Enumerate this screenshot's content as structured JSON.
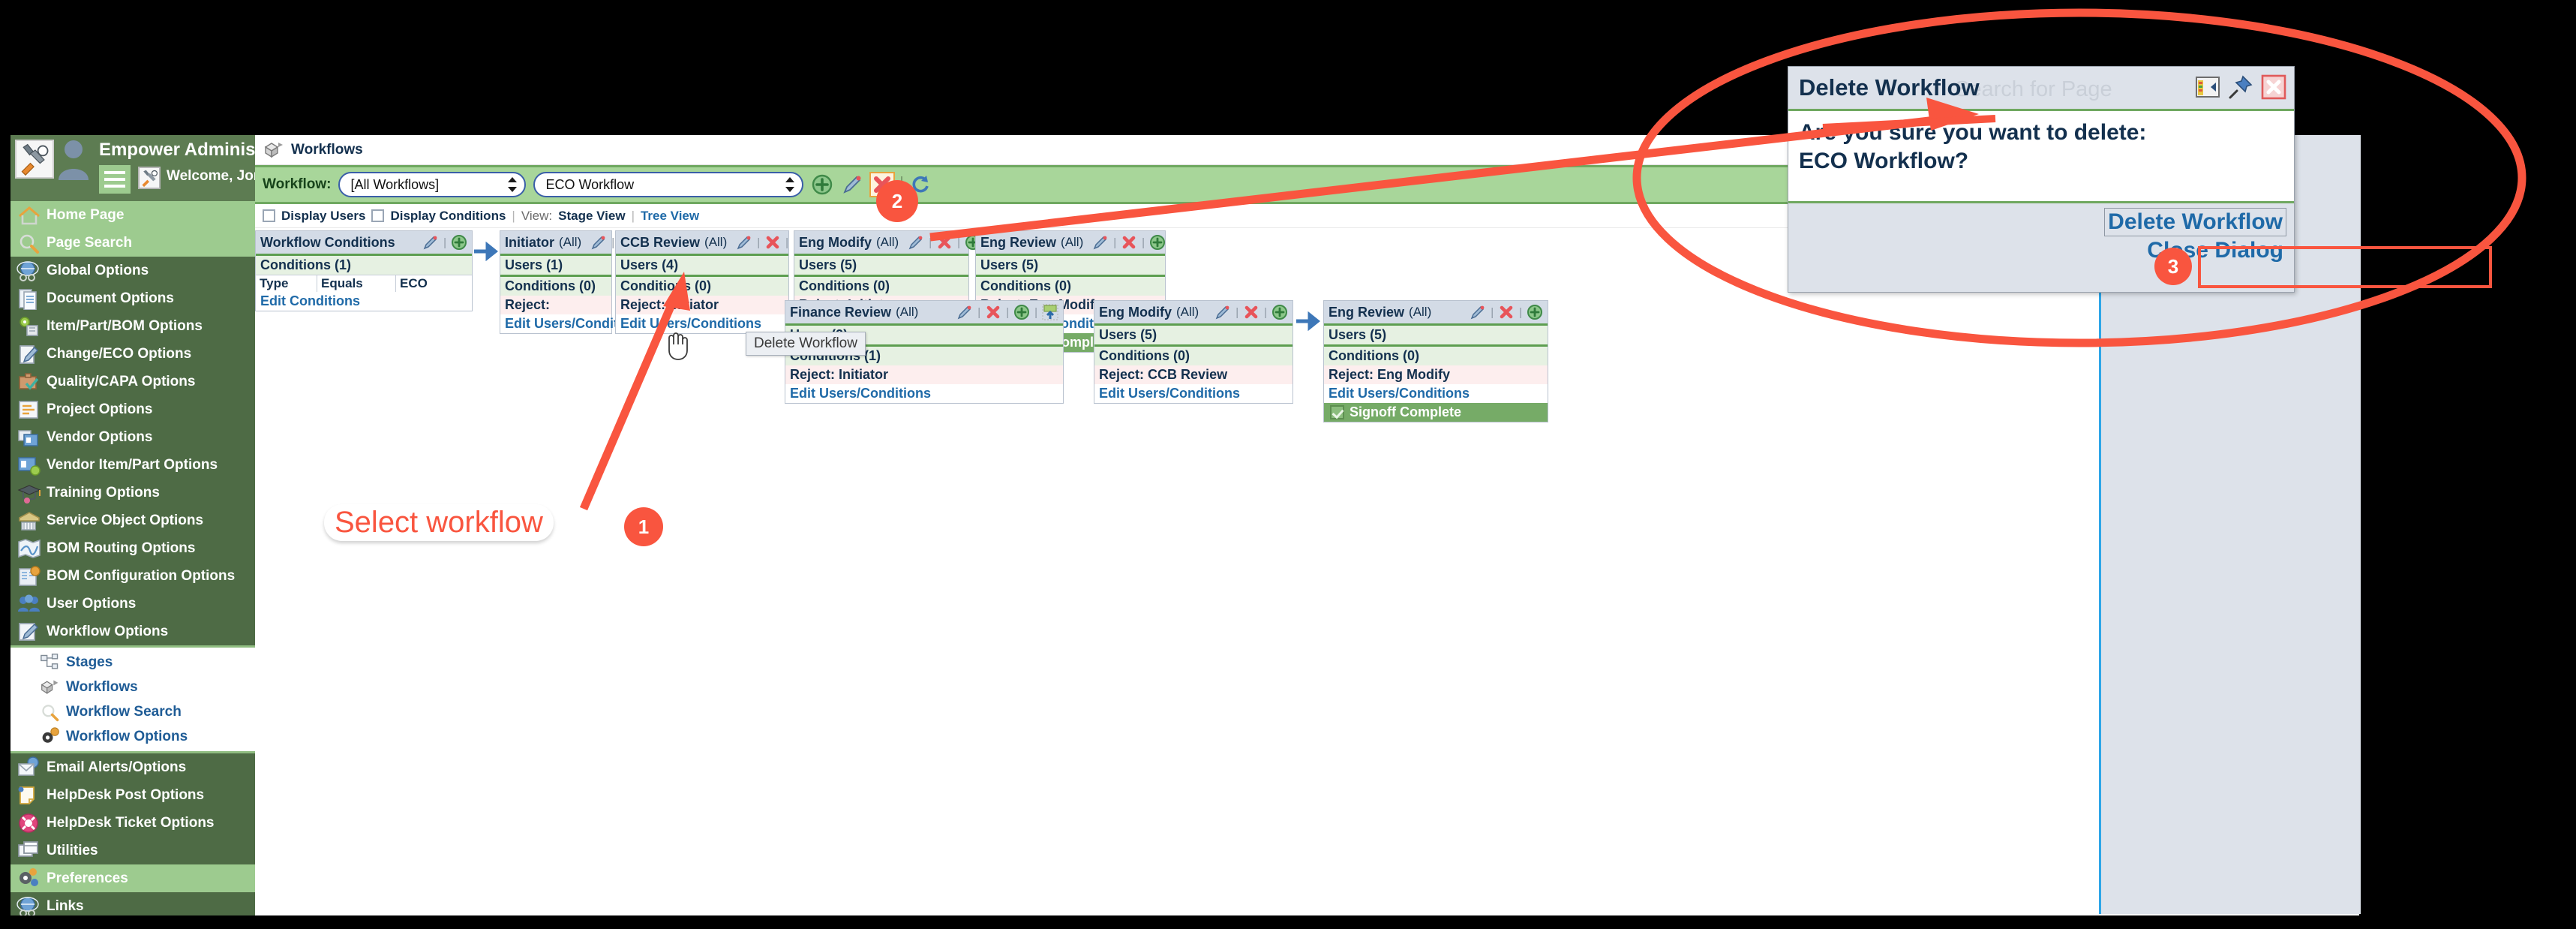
{
  "header": {
    "app_title": "Empower Administrator",
    "welcome": "Welcome, Jonathan Cohn",
    "logo_icon": "tools-logo-icon",
    "avatar_icon": "user-avatar-icon",
    "menu_icon": "hamburger-menu-icon",
    "caret_icon": "chevron-down-icon"
  },
  "sidebar": {
    "items": [
      {
        "label": "Home Page",
        "icon": "home-icon",
        "highlight": true
      },
      {
        "label": "Page Search",
        "icon": "magnifier-icon",
        "highlight": true
      },
      {
        "label": "Global Options",
        "icon": "globe-icon",
        "highlight": false
      },
      {
        "label": "Document Options",
        "icon": "documents-icon",
        "highlight": false
      },
      {
        "label": "Item/Part/BOM Options",
        "icon": "gear-chip-icon",
        "highlight": false
      },
      {
        "label": "Change/ECO Options",
        "icon": "notepad-pencil-icon",
        "highlight": false
      },
      {
        "label": "Quality/CAPA Options",
        "icon": "briefcase-check-icon",
        "highlight": false
      },
      {
        "label": "Project Options",
        "icon": "gantt-icon",
        "highlight": false
      },
      {
        "label": "Vendor Options",
        "icon": "vendor-cards-icon",
        "highlight": false
      },
      {
        "label": "Vendor Item/Part Options",
        "icon": "vendor-gear-icon",
        "highlight": false
      },
      {
        "label": "Training Options",
        "icon": "graduation-cap-icon",
        "highlight": false
      },
      {
        "label": "Service Object Options",
        "icon": "service-box-icon",
        "highlight": false
      },
      {
        "label": "BOM Routing Options",
        "icon": "routing-map-icon",
        "highlight": false
      },
      {
        "label": "BOM Configuration Options",
        "icon": "config-gear-icon",
        "highlight": false
      },
      {
        "label": "User Options",
        "icon": "users-group-icon",
        "highlight": false
      },
      {
        "label": "Workflow Options",
        "icon": "workflow-pencil-icon",
        "highlight": false
      }
    ],
    "subitems": [
      {
        "label": "Stages",
        "icon": "stages-icon"
      },
      {
        "label": "Workflows",
        "icon": "workflow-box-icon"
      },
      {
        "label": "Workflow Search",
        "icon": "magnifier-icon"
      },
      {
        "label": "Workflow Options",
        "icon": "gear-icon"
      }
    ],
    "items_after": [
      {
        "label": "Email Alerts/Options",
        "icon": "email-globe-icon",
        "highlight": false
      },
      {
        "label": "HelpDesk Post Options",
        "icon": "sticky-note-icon",
        "highlight": false
      },
      {
        "label": "HelpDesk Ticket Options",
        "icon": "lifering-icon",
        "highlight": false
      },
      {
        "label": "Utilities",
        "icon": "windows-stack-icon",
        "highlight": false
      },
      {
        "label": "Preferences",
        "icon": "gear-user-icon",
        "highlight": true
      },
      {
        "label": "Links",
        "icon": "globe-icon",
        "highlight": false
      }
    ]
  },
  "page": {
    "title": "Workflows",
    "title_icon": "workflow-box-icon"
  },
  "workflow_bar": {
    "label": "Workflow:",
    "filter_select_value": "[All Workflows]",
    "workflow_select_value": "ECO Workflow",
    "add_icon": "plus-circle-icon",
    "edit_icon": "pencil-icon",
    "delete_icon": "red-x-icon",
    "refresh_icon": "refresh-icon"
  },
  "options_bar": {
    "display_users": "Display Users",
    "display_conditions": "Display Conditions",
    "view_label": "View:",
    "view_current": "Stage View",
    "view_alt": "Tree View"
  },
  "tooltip": {
    "text": "Delete Workflow"
  },
  "cards": {
    "conditions": {
      "title": "Workflow Conditions",
      "conditions_label": "Conditions",
      "conditions_count": "(1)",
      "table": [
        "Type",
        "Equals",
        "ECO"
      ],
      "edit_link": "Edit Conditions"
    },
    "stages_row1": [
      {
        "title": "Initiator",
        "all": "(All)",
        "users": "Users",
        "users_count": "(1)",
        "conditions": "Conditions",
        "conditions_count": "(0)",
        "reject": "Reject:",
        "reject_to": "",
        "edit_link": "Edit Users/Conditions",
        "signoff": null,
        "has_delete": true,
        "has_export": false
      },
      {
        "title": "CCB Review",
        "all": "(All)",
        "users": "Users",
        "users_count": "(4)",
        "conditions": "Conditions",
        "conditions_count": "(0)",
        "reject": "Reject:",
        "reject_to": "Initiator",
        "edit_link": "Edit Users/Conditions",
        "signoff": null,
        "has_delete": true,
        "has_export": false
      },
      {
        "title": "Eng Modify",
        "all": "(All)",
        "users": "Users",
        "users_count": "(5)",
        "conditions": "Conditions",
        "conditions_count": "(0)",
        "reject": "Reject:",
        "reject_to": "Initiator",
        "edit_link": "Edit Users/Conditions",
        "signoff": null,
        "has_delete": true,
        "has_export": true
      },
      {
        "title": "Eng Review",
        "all": "(All)",
        "users": "Users",
        "users_count": "(5)",
        "conditions": "Conditions",
        "conditions_count": "(0)",
        "reject": "Reject:",
        "reject_to": "Eng Modify",
        "edit_link": "Edit Users/Conditions",
        "signoff": "Signoff Complete",
        "has_delete": true,
        "has_export": false
      }
    ],
    "stages_row2": [
      {
        "title": "Finance Review",
        "all": "(All)",
        "users": "Users",
        "users_count": "(2)",
        "conditions": "Conditions",
        "conditions_count": "(1)",
        "reject": "Reject:",
        "reject_to": "Initiator",
        "edit_link": "Edit Users/Conditions",
        "signoff": null,
        "has_delete": true,
        "has_export": true
      },
      {
        "title": "Eng Modify",
        "all": "(All)",
        "users": "Users",
        "users_count": "(5)",
        "conditions": "Conditions",
        "conditions_count": "(0)",
        "reject": "Reject:",
        "reject_to": "CCB Review",
        "edit_link": "Edit Users/Conditions",
        "signoff": null,
        "has_delete": true,
        "has_export": false
      },
      {
        "title": "Eng Review",
        "all": "(All)",
        "users": "Users",
        "users_count": "(5)",
        "conditions": "Conditions",
        "conditions_count": "(0)",
        "reject": "Reject:",
        "reject_to": "Eng Modify",
        "edit_link": "Edit Users/Conditions",
        "signoff": "Signoff Complete",
        "has_delete": true,
        "has_export": false
      }
    ]
  },
  "dialog": {
    "title": "Delete Workflow",
    "ghost_text": "Search for Page",
    "question_line1": "Are you sure you want to delete:",
    "question_line2": "ECO Workflow?",
    "confirm_label": "Delete Workflow",
    "close_label": "Close Dialog",
    "restore_icon": "restore-panel-icon",
    "pin_icon": "pin-icon",
    "close_icon": "close-x-icon"
  },
  "annotations": {
    "step1_label": "Select workflow",
    "step1_badge": "1",
    "step2_badge": "2",
    "step3_badge": "3",
    "accent_color": "#f9553f"
  }
}
